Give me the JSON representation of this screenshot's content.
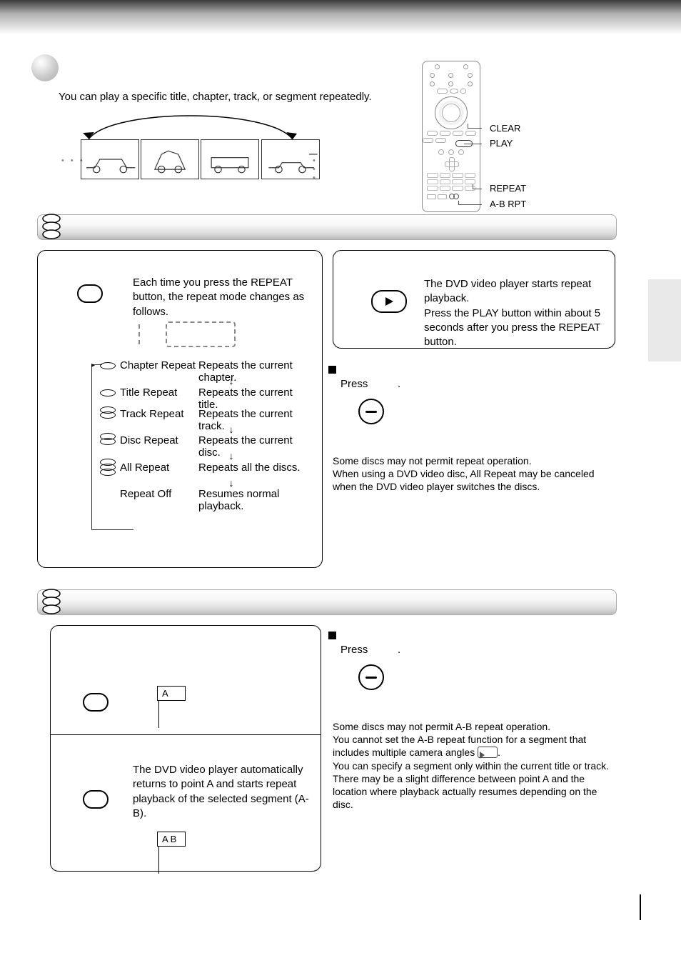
{
  "intro": "You can play a specific title, chapter, track, or segment repeatedly.",
  "remote": {
    "clear": "CLEAR",
    "play": "PLAY",
    "repeat": "REPEAT",
    "abrpt": "A-B RPT"
  },
  "section1": {
    "step1": {
      "text": "Each time you press the REPEAT button, the repeat mode changes as follows."
    },
    "modes": [
      {
        "label": "Chapter Repeat",
        "desc": "Repeats the current chapter."
      },
      {
        "label": "Title Repeat",
        "desc": "Repeats the current title."
      },
      {
        "label": "Track Repeat",
        "desc": "Repeats the current track."
      },
      {
        "label": "Disc Repeat",
        "desc": "Repeats the current disc."
      },
      {
        "label": "All Repeat",
        "desc": "Repeats all the discs."
      },
      {
        "label": "Repeat Off",
        "desc": "Resumes normal playback."
      }
    ],
    "step2": {
      "text": "The DVD video player starts repeat playback.\nPress the PLAY button within about 5 seconds after you press the REPEAT button."
    },
    "cancel": {
      "press": "Press",
      "dot": "."
    },
    "notes": "Some discs may not permit repeat operation.\nWhen using a DVD video disc,  All Repeat  may be canceled when the DVD video player switches the discs."
  },
  "section2": {
    "step1": {
      "ind": "A"
    },
    "step2": {
      "text": "The DVD video player automatically returns to point A and starts repeat playback of the selected segment (A-B).",
      "ind": "A  B"
    },
    "cancel": {
      "press": "Press",
      "dot": "."
    },
    "notes_l1": "Some discs may not permit A-B repeat operation.",
    "notes_l2": "You cannot set the A-B repeat function for a segment that includes multiple camera angles ",
    "notes_l2b": ".",
    "notes_l3": "You can specify a segment only within the current title or track.",
    "notes_l4": "There may be a slight difference between point A and the location where playback actually resumes depending on the disc."
  }
}
